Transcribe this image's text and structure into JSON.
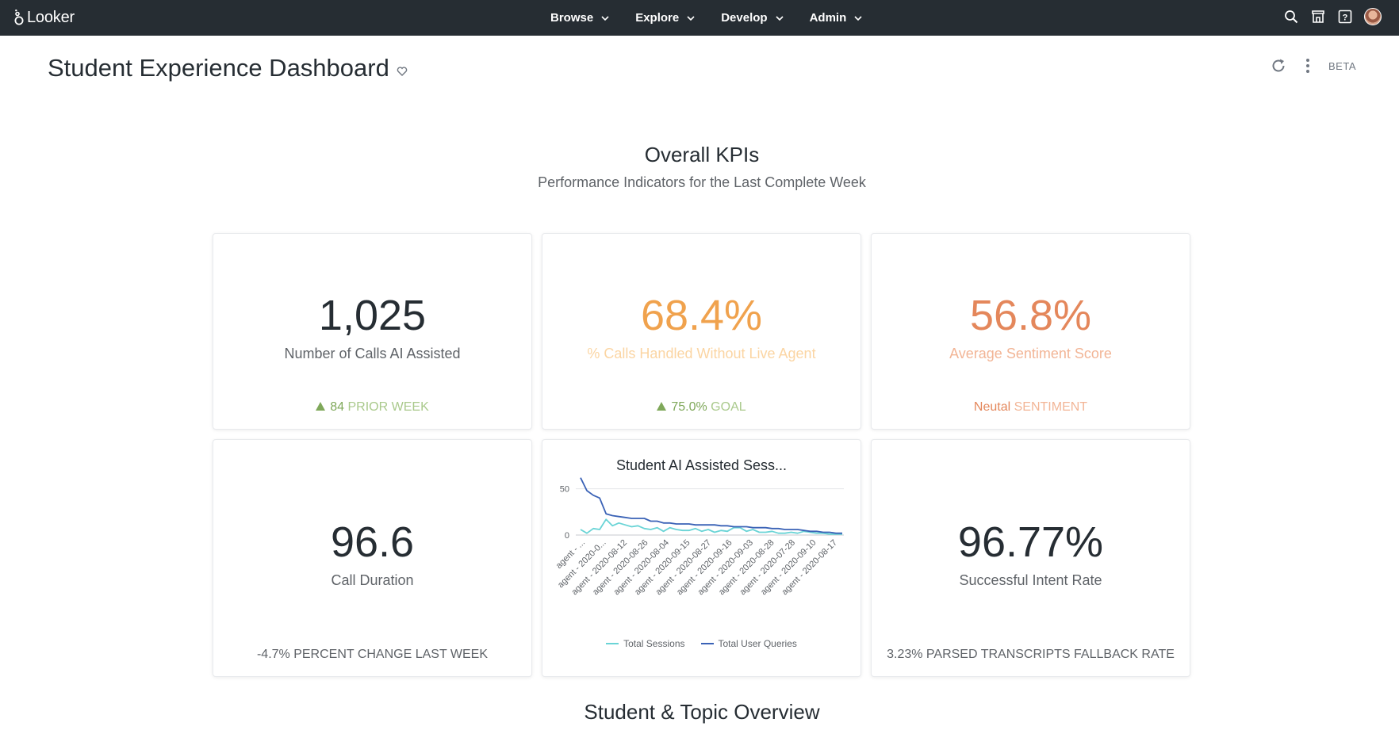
{
  "app": {
    "brand": "Looker"
  },
  "nav": {
    "items": [
      {
        "label": "Browse"
      },
      {
        "label": "Explore"
      },
      {
        "label": "Develop"
      },
      {
        "label": "Admin"
      }
    ]
  },
  "icons": {
    "search": "search-icon",
    "marketplace": "marketplace-icon",
    "help": "help-icon",
    "refresh": "refresh-icon",
    "more": "more-vert-icon",
    "favorite": "heart-icon"
  },
  "dashboard": {
    "title": "Student Experience Dashboard",
    "beta_label": "BETA"
  },
  "sections": {
    "kpis": {
      "title": "Overall KPIs",
      "subtitle": "Performance Indicators for the Last Complete Week"
    },
    "overview": {
      "title": "Student & Topic Overview"
    }
  },
  "colors": {
    "dark": "#262d33",
    "green": "#7fa85a",
    "orange": "#f0a24d",
    "orange_light": "#fbd5a3",
    "coral": "#e4875b",
    "coral_light": "#f2b596",
    "session_line": "#6ad4d6",
    "query_line": "#3a62b6"
  },
  "tiles": {
    "calls_ai": {
      "value": "1,025",
      "label": "Number of Calls AI Assisted",
      "foot_value": "84",
      "foot_label": "PRIOR WEEK"
    },
    "without_agent": {
      "value": "68.4%",
      "label": "% Calls Handled Without Live Agent",
      "foot_value": "75.0%",
      "foot_label": "GOAL"
    },
    "sentiment": {
      "value": "56.8%",
      "label": "Average Sentiment Score",
      "foot_value": "Neutal",
      "foot_label": "SENTIMENT"
    },
    "call_duration": {
      "value": "96.6",
      "label": "Call Duration",
      "foot": "-4.7% PERCENT CHANGE LAST WEEK"
    },
    "intent_rate": {
      "value": "96.77%",
      "label": "Successful Intent Rate",
      "foot": "3.23% PARSED TRANSCRIPTS FALLBACK RATE"
    }
  },
  "chart_data": {
    "type": "line",
    "title": "Student AI Assisted Sess...",
    "xlabel": "",
    "ylabel": "",
    "ylim": [
      0,
      60
    ],
    "yticks": [
      0,
      50
    ],
    "tick_labels": [
      "agent - ...",
      "agent - 2020-0...",
      "agent - 2020-08-12",
      "agent - 2020-08-26",
      "agent - 2020-08-04",
      "agent - 2020-09-15",
      "agent - 2020-08-27",
      "agent - 2020-09-16",
      "agent - 2020-09-03",
      "agent - 2020-08-28",
      "agent - 2020-07-28",
      "agent - 2020-09-10",
      "agent - 2020-08-17"
    ],
    "grid": true,
    "legend_position": "bottom",
    "series": [
      {
        "name": "Total Sessions",
        "color": "#6ad4d6",
        "values": [
          6,
          2,
          7,
          6,
          17,
          10,
          13,
          11,
          9,
          10,
          7,
          6,
          8,
          4,
          8,
          6,
          5,
          5,
          7,
          4,
          6,
          3,
          5,
          4,
          8,
          8,
          4,
          6,
          3,
          3,
          4,
          2,
          2,
          3,
          2,
          4,
          3,
          2,
          2,
          1,
          1,
          1
        ]
      },
      {
        "name": "Total User Queries",
        "color": "#3a62b6",
        "values": [
          62,
          48,
          43,
          40,
          23,
          21,
          20,
          19,
          18,
          18,
          18,
          15,
          15,
          13,
          13,
          12,
          12,
          12,
          11,
          11,
          11,
          11,
          10,
          10,
          9,
          9,
          9,
          8,
          8,
          8,
          7,
          7,
          6,
          6,
          6,
          5,
          4,
          4,
          3,
          3,
          2,
          2
        ]
      }
    ]
  }
}
